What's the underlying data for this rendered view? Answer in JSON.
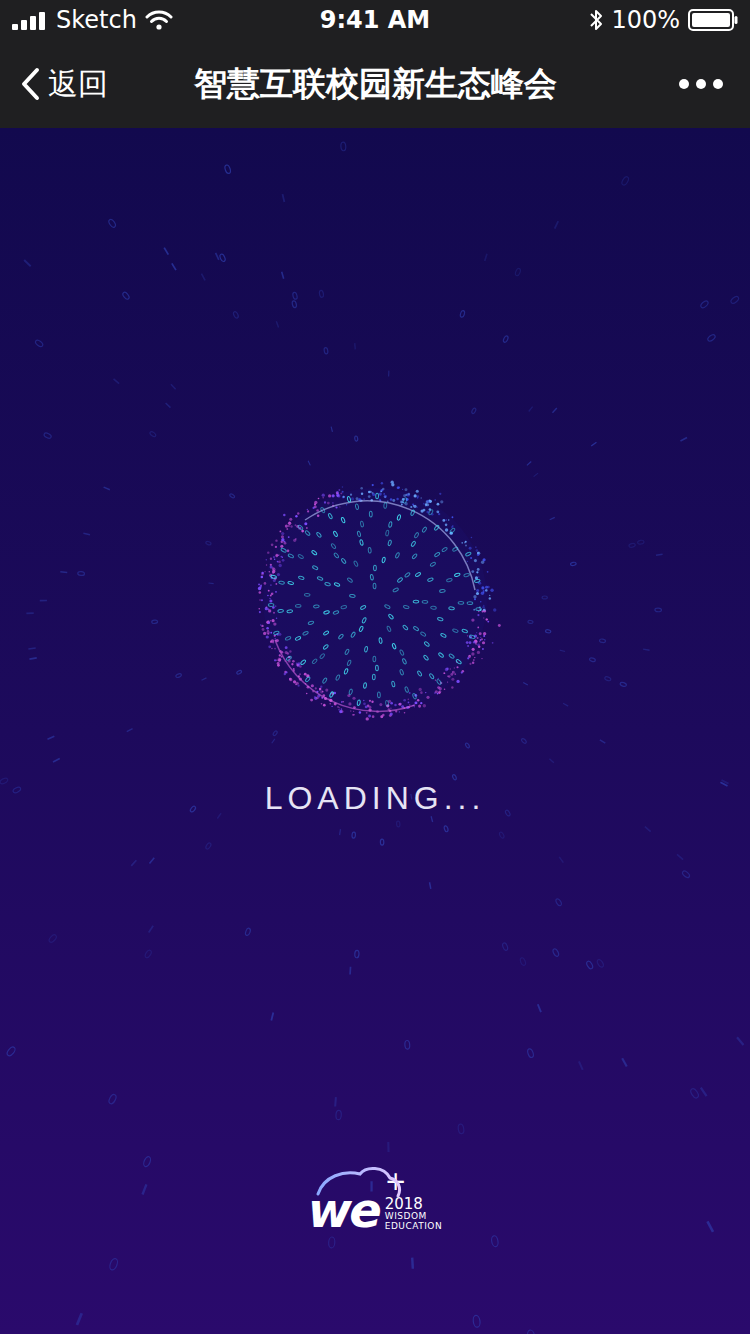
{
  "status_bar": {
    "carrier": "Sketch",
    "signal_bars": 4,
    "time": "9:41 AM",
    "battery": {
      "reading": "100%",
      "level": 1
    }
  },
  "nav_bar": {
    "back": "返回",
    "title": "智慧互联校园新生态峰会"
  },
  "loader": {
    "text": "LOADING..."
  },
  "logo": {
    "mark": "we",
    "plus": "+",
    "year": "2018",
    "lines": [
      "WISDOM",
      "EDUCATION"
    ]
  }
}
